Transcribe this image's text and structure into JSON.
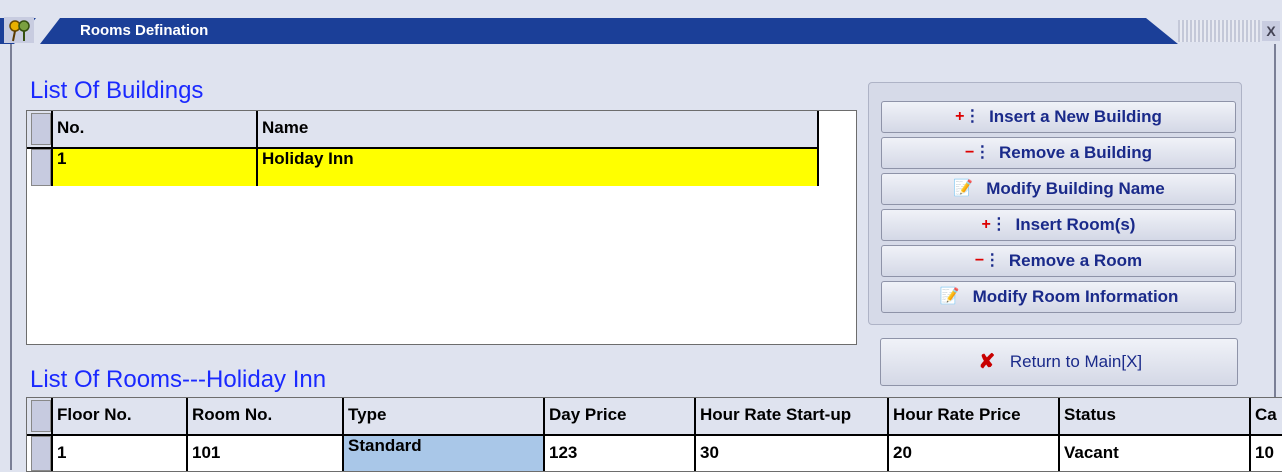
{
  "window": {
    "title": "Rooms Defination",
    "close_glyph": "X"
  },
  "buildings": {
    "heading": "List Of Buildings",
    "columns": [
      "No.",
      "Name"
    ],
    "rows": [
      {
        "no": "1",
        "name": "Holiday Inn"
      }
    ]
  },
  "actions": {
    "insert_building": "Insert a New Building",
    "remove_building": "Remove a Building",
    "modify_building": "Modify Building Name",
    "insert_rooms": "Insert Room(s)",
    "remove_room": "Remove a Room",
    "modify_room": "Modify Room Information",
    "return_main": "Return to Main[X]"
  },
  "rooms": {
    "heading": "List Of Rooms---Holiday Inn",
    "columns": [
      "Floor No.",
      "Room No.",
      "Type",
      "Day Price",
      "Hour Rate Start-up",
      "Hour Rate Price",
      "Status",
      "Ca"
    ],
    "rows": [
      {
        "floor": "1",
        "room": "101",
        "type": "Standard",
        "day_price": "123",
        "hour_start": "30",
        "hour_price": "20",
        "status": "Vacant",
        "ca": "10"
      }
    ]
  },
  "colors": {
    "heading": "#1a29ff",
    "selected_row": "#ffff00",
    "titlebar": "#1a3a8a"
  }
}
